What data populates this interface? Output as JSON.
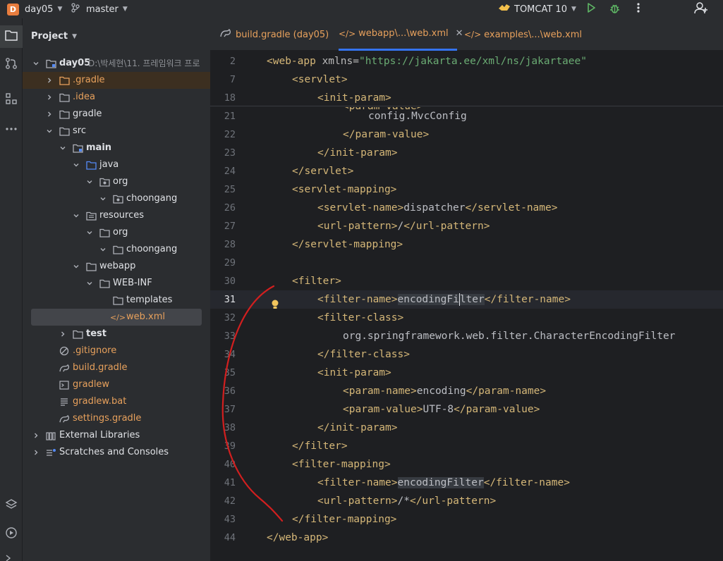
{
  "titlebar": {
    "project_badge": "D",
    "project_name": "day05",
    "branch_name": "master",
    "run_config": "TOMCAT 10",
    "icons": [
      "run-icon",
      "debug-icon",
      "more-icon",
      "add-user-icon"
    ]
  },
  "project_panel": {
    "title": "Project",
    "tree": [
      {
        "label": "day05",
        "suffix": "D:\\박세현\\11. 프레임워크 프로",
        "level": 0,
        "arrow": "down",
        "icon": "module-folder",
        "bold": true
      },
      {
        "label": ".gradle",
        "level": 1,
        "arrow": "right",
        "icon": "folder-orange",
        "color": "orange",
        "highlight": true
      },
      {
        "label": ".idea",
        "level": 1,
        "arrow": "right",
        "icon": "folder",
        "color": "orange"
      },
      {
        "label": "gradle",
        "level": 1,
        "arrow": "right",
        "icon": "folder"
      },
      {
        "label": "src",
        "level": 1,
        "arrow": "down",
        "icon": "folder"
      },
      {
        "label": "main",
        "level": 2,
        "arrow": "down",
        "icon": "module-folder",
        "bold": true
      },
      {
        "label": "java",
        "level": 3,
        "arrow": "down",
        "icon": "folder-blue"
      },
      {
        "label": "org",
        "level": 4,
        "arrow": "down",
        "icon": "package"
      },
      {
        "label": "choongang",
        "level": 5,
        "arrow": "down",
        "icon": "package"
      },
      {
        "label": "resources",
        "level": 3,
        "arrow": "down",
        "icon": "resources-folder"
      },
      {
        "label": "org",
        "level": 4,
        "arrow": "down",
        "icon": "folder"
      },
      {
        "label": "choongang",
        "level": 5,
        "arrow": "down",
        "icon": "folder"
      },
      {
        "label": "webapp",
        "level": 3,
        "arrow": "down",
        "icon": "folder"
      },
      {
        "label": "WEB-INF",
        "level": 4,
        "arrow": "down",
        "icon": "folder"
      },
      {
        "label": "templates",
        "level": 5,
        "arrow": "none",
        "icon": "folder"
      },
      {
        "label": "web.xml",
        "level": 5,
        "arrow": "none",
        "icon": "xml-file",
        "color": "orange",
        "selected": true
      },
      {
        "label": "test",
        "level": 2,
        "arrow": "right",
        "icon": "folder",
        "bold": true
      },
      {
        "label": ".gitignore",
        "level": 1,
        "arrow": "none",
        "icon": "ignore-file",
        "color": "orange"
      },
      {
        "label": "build.gradle",
        "level": 1,
        "arrow": "none",
        "icon": "gradle-file",
        "color": "orange"
      },
      {
        "label": "gradlew",
        "level": 1,
        "arrow": "none",
        "icon": "shell-file",
        "color": "orange"
      },
      {
        "label": "gradlew.bat",
        "level": 1,
        "arrow": "none",
        "icon": "text-file",
        "color": "orange"
      },
      {
        "label": "settings.gradle",
        "level": 1,
        "arrow": "none",
        "icon": "gradle-file",
        "color": "orange"
      },
      {
        "label": "External Libraries",
        "level": 0,
        "arrow": "right",
        "icon": "library"
      },
      {
        "label": "Scratches and Consoles",
        "level": 0,
        "arrow": "right",
        "icon": "scratches"
      }
    ]
  },
  "tabs": [
    {
      "label": "build.gradle (day05)",
      "icon": "gradle-icon",
      "active": false
    },
    {
      "label": "webapp\\...\\web.xml",
      "icon": "xml-icon",
      "active": true,
      "closable": true
    },
    {
      "label": "examples\\...\\web.xml",
      "icon": "xml-icon",
      "active": false
    }
  ],
  "editor": {
    "current_line": "31",
    "lines": [
      {
        "n": "2",
        "indent": 0,
        "parts": [
          [
            "tag",
            "<web-app "
          ],
          [
            "attr",
            "xmlns="
          ],
          [
            "str",
            "\"https://jakarta.ee/xml/ns/jakartaee\""
          ]
        ]
      },
      {
        "n": "7",
        "indent": 1,
        "parts": [
          [
            "tag",
            "<servlet>"
          ]
        ]
      },
      {
        "n": "18",
        "indent": 2,
        "parts": [
          [
            "tag",
            "<init-param>"
          ]
        ]
      },
      {
        "n": "21",
        "indent": 4,
        "parts": [
          [
            "txt",
            "config.MvcConfig"
          ]
        ]
      },
      {
        "n": "22",
        "indent": 3,
        "parts": [
          [
            "tag",
            "</param-value>"
          ]
        ]
      },
      {
        "n": "23",
        "indent": 2,
        "parts": [
          [
            "tag",
            "</init-param>"
          ]
        ]
      },
      {
        "n": "24",
        "indent": 1,
        "parts": [
          [
            "tag",
            "</servlet>"
          ]
        ]
      },
      {
        "n": "25",
        "indent": 1,
        "parts": [
          [
            "tag",
            "<servlet-mapping>"
          ]
        ]
      },
      {
        "n": "26",
        "indent": 2,
        "parts": [
          [
            "tag",
            "<servlet-name>"
          ],
          [
            "txt",
            "dispatcher"
          ],
          [
            "tag",
            "</servlet-name>"
          ]
        ]
      },
      {
        "n": "27",
        "indent": 2,
        "parts": [
          [
            "tag",
            "<url-pattern>"
          ],
          [
            "txt",
            "/"
          ],
          [
            "tag",
            "</url-pattern>"
          ]
        ]
      },
      {
        "n": "28",
        "indent": 1,
        "parts": [
          [
            "tag",
            "</servlet-mapping>"
          ]
        ]
      },
      {
        "n": "29",
        "indent": 0,
        "parts": []
      },
      {
        "n": "30",
        "indent": 1,
        "parts": [
          [
            "tag",
            "<filter>"
          ]
        ]
      },
      {
        "n": "31",
        "indent": 2,
        "parts": [
          [
            "tag",
            "<filter-name>"
          ],
          [
            "hl",
            "encodingFi"
          ],
          [
            "caret",
            ""
          ],
          [
            "hl",
            "lter"
          ],
          [
            "tag",
            "</filter-name>"
          ]
        ]
      },
      {
        "n": "32",
        "indent": 2,
        "parts": [
          [
            "tag",
            "<filter-class>"
          ]
        ]
      },
      {
        "n": "33",
        "indent": 3,
        "parts": [
          [
            "txt",
            "org.springframework.web.filter.CharacterEncodingFilter"
          ]
        ]
      },
      {
        "n": "34",
        "indent": 2,
        "parts": [
          [
            "tag",
            "</filter-class>"
          ]
        ]
      },
      {
        "n": "35",
        "indent": 2,
        "parts": [
          [
            "tag",
            "<init-param>"
          ]
        ]
      },
      {
        "n": "36",
        "indent": 3,
        "parts": [
          [
            "tag",
            "<param-name>"
          ],
          [
            "txt",
            "encoding"
          ],
          [
            "tag",
            "</param-name>"
          ]
        ]
      },
      {
        "n": "37",
        "indent": 3,
        "parts": [
          [
            "tag",
            "<param-value>"
          ],
          [
            "txt",
            "UTF-8"
          ],
          [
            "tag",
            "</param-value>"
          ]
        ]
      },
      {
        "n": "38",
        "indent": 2,
        "parts": [
          [
            "tag",
            "</init-param>"
          ]
        ]
      },
      {
        "n": "39",
        "indent": 1,
        "parts": [
          [
            "tag",
            "</filter>"
          ]
        ]
      },
      {
        "n": "40",
        "indent": 1,
        "parts": [
          [
            "tag",
            "<filter-mapping>"
          ]
        ]
      },
      {
        "n": "41",
        "indent": 2,
        "parts": [
          [
            "tag",
            "<filter-name>"
          ],
          [
            "hl",
            "encodingFilter"
          ],
          [
            "tag",
            "</filter-name>"
          ]
        ]
      },
      {
        "n": "42",
        "indent": 2,
        "parts": [
          [
            "tag",
            "<url-pattern>"
          ],
          [
            "txt",
            "/*"
          ],
          [
            "tag",
            "</url-pattern>"
          ]
        ]
      },
      {
        "n": "43",
        "indent": 1,
        "parts": [
          [
            "tag",
            "</filter-mapping>"
          ]
        ]
      },
      {
        "n": "44",
        "indent": 0,
        "parts": [
          [
            "tag",
            "</web-app>"
          ]
        ]
      }
    ],
    "partial_hidden_line": "<param-value>"
  },
  "colors": {
    "accent": "#3574f0",
    "tag": "#d5b778",
    "string": "#6aab73",
    "orange_text": "#e8a15c",
    "annotation_red": "#d21f1f"
  }
}
